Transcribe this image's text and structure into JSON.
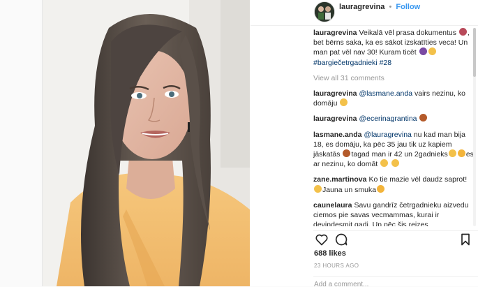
{
  "header": {
    "username": "lauragrevina",
    "separator": "•",
    "follow_label": "Follow"
  },
  "caption": {
    "user": "lauragrevina",
    "text": "Veikalā vēl prasa dokumentus",
    "text2": ", bet bērns saka, ka es sākot izskatīties veca! Un man pat vēl nav 30! Kuram ticēt",
    "hashtag1": "#bargiečetrgadnieki",
    "hashtag2": "#28"
  },
  "view_all": "View all 31 comments",
  "comments": [
    {
      "user": "lauragrevina",
      "mention": "@lasmane.anda",
      "text": " vairs nezinu, ko domāju"
    },
    {
      "user": "lauragrevina",
      "mention": "@ecerinagrantina",
      "text": ""
    },
    {
      "user": "lasmane.anda",
      "mention": "@lauragrevina",
      "text": " nu kad man bija 18, es domāju, ka pēc 35 jau tik uz kapiem jāskatās",
      "text2": "tagad man ir 42 un 2gadnieks",
      "text3": "es ar nezinu, ko domāt"
    },
    {
      "user": "zane.martinova",
      "mention": "",
      "text": "Ko tie mazie vēl daudz saprot!",
      "text2": "Jauna un smuka"
    },
    {
      "user": "caunelaura",
      "mention": "",
      "text": "Savu gandrīz četrgadnieku aizvedu ciemos pie savas vecmammas, kurai ir deviņdesmit gadi. Un pēc šis reizes"
    }
  ],
  "likes": "688 likes",
  "timestamp": "23 HOURS AGO",
  "add_comment_placeholder": "Add a comment...",
  "icons": [
    "heart-icon",
    "comment-icon",
    "bookmark-icon"
  ],
  "colors": {
    "follow": "#3897f0",
    "link": "#003569",
    "muted": "#999999"
  }
}
